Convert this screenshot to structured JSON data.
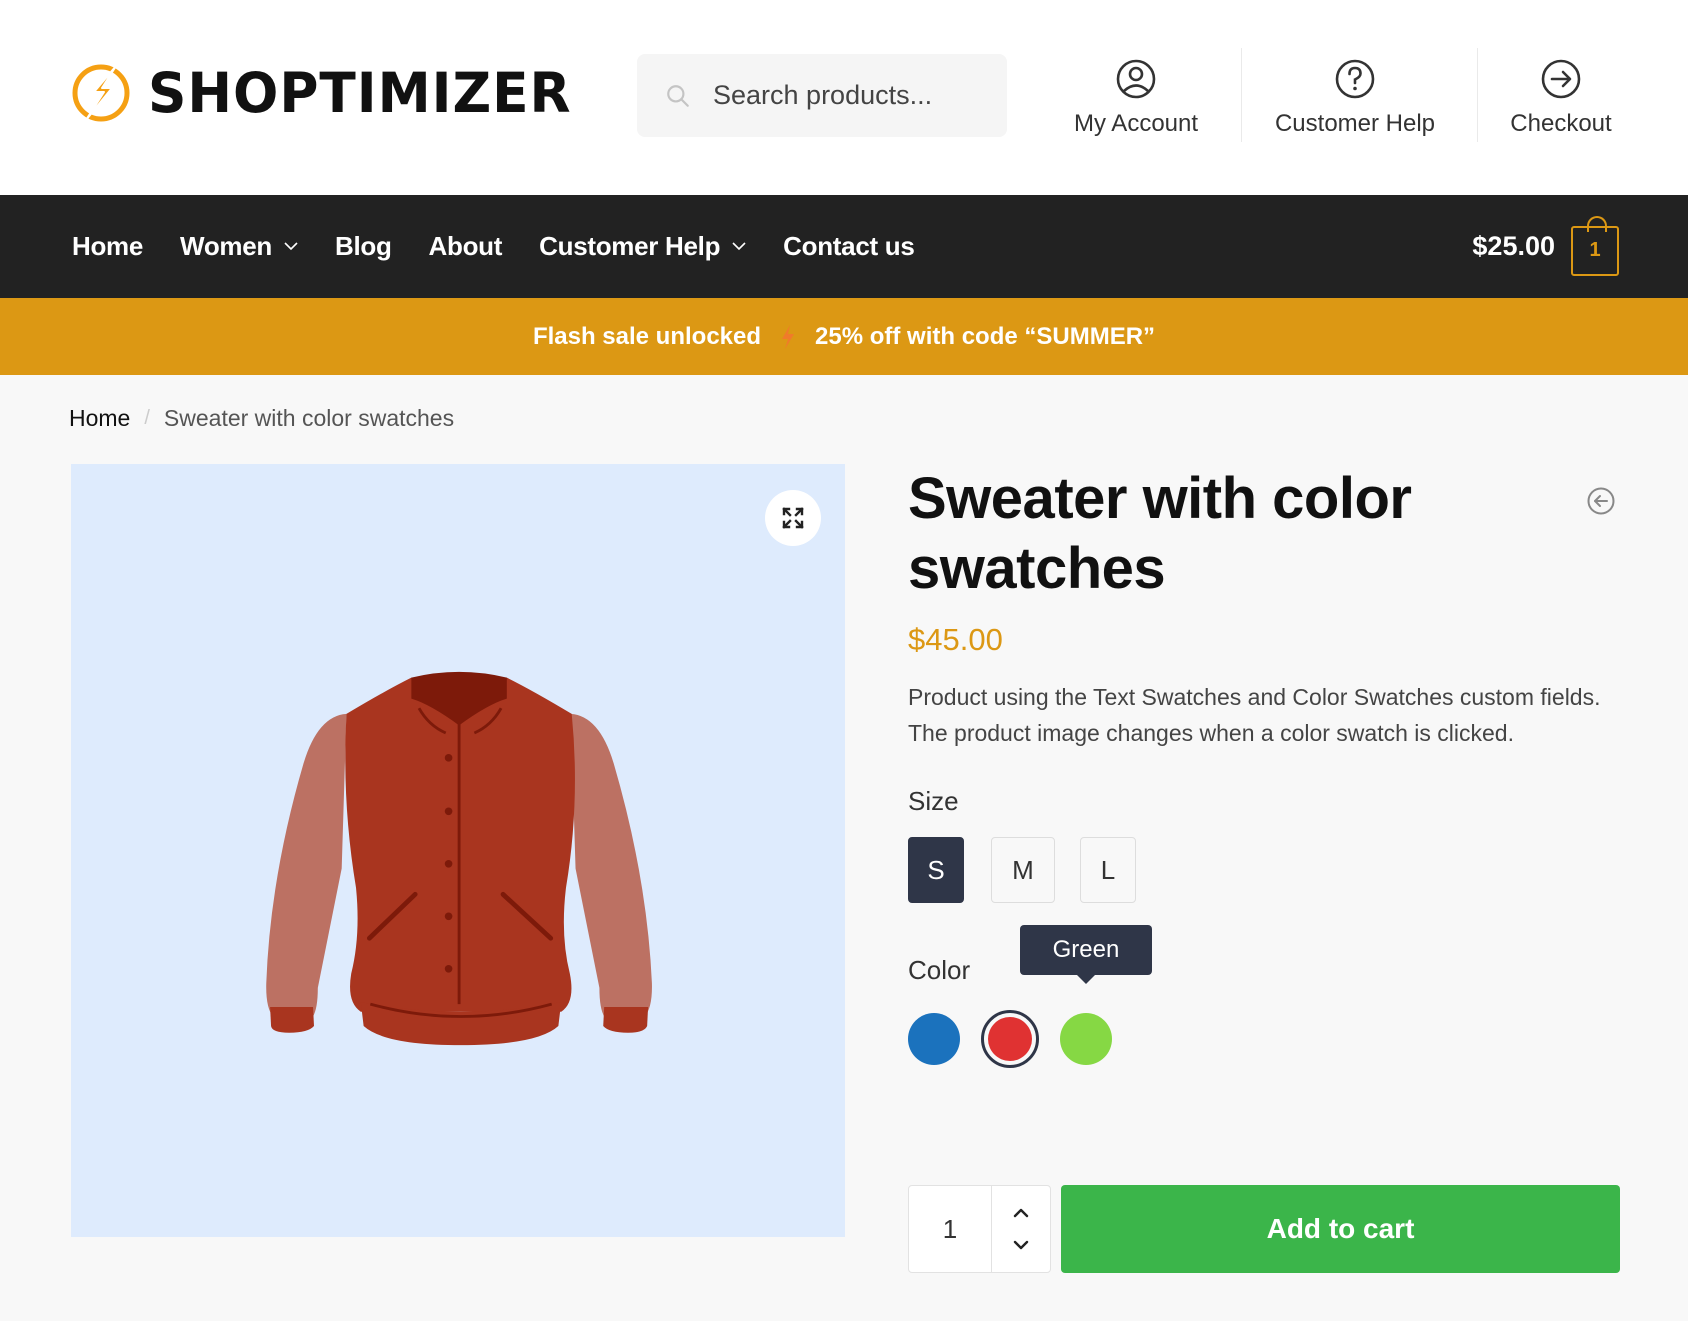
{
  "header": {
    "logo_text": "SHOPTIMIZER",
    "search": {
      "placeholder": "Search products...",
      "value": ""
    },
    "links": [
      {
        "label": "My Account",
        "icon": "user-circle-icon"
      },
      {
        "label": "Customer Help",
        "icon": "question-circle-icon"
      },
      {
        "label": "Checkout",
        "icon": "arrow-right-circle-icon"
      }
    ]
  },
  "nav": {
    "items": [
      {
        "label": "Home",
        "has_dropdown": false
      },
      {
        "label": "Women",
        "has_dropdown": true
      },
      {
        "label": "Blog",
        "has_dropdown": false
      },
      {
        "label": "About",
        "has_dropdown": false
      },
      {
        "label": "Customer Help",
        "has_dropdown": true
      },
      {
        "label": "Contact us",
        "has_dropdown": false
      }
    ],
    "cart_total": "$25.00",
    "cart_count": "1"
  },
  "banner": {
    "text_left": "Flash sale unlocked",
    "text_right": "25% off with code “SUMMER”"
  },
  "breadcrumb": {
    "home": "Home",
    "separator": "/",
    "current": "Sweater with color swatches"
  },
  "product": {
    "title": "Sweater with color swatches",
    "price": "$45.00",
    "description": "Product using the Text Swatches and Color Swatches custom fields. The product image changes when a color swatch is clicked.",
    "size": {
      "label": "Size",
      "options": [
        "S",
        "M",
        "L"
      ],
      "selected": "S"
    },
    "color": {
      "label": "Color",
      "options": [
        {
          "name": "Blue",
          "hex": "#1b72bd"
        },
        {
          "name": "Red",
          "hex": "#e03232"
        },
        {
          "name": "Green",
          "hex": "#86d844"
        }
      ],
      "selected": "Red",
      "tooltip": "Green"
    },
    "quantity": "1",
    "add_to_cart_label": "Add to cart"
  },
  "colors": {
    "brand_accent": "#dc9814",
    "nav_bg": "#222222",
    "button_green": "#3bb54a",
    "swatch_active": "#2f3648",
    "gallery_bg": "#deebfd"
  }
}
